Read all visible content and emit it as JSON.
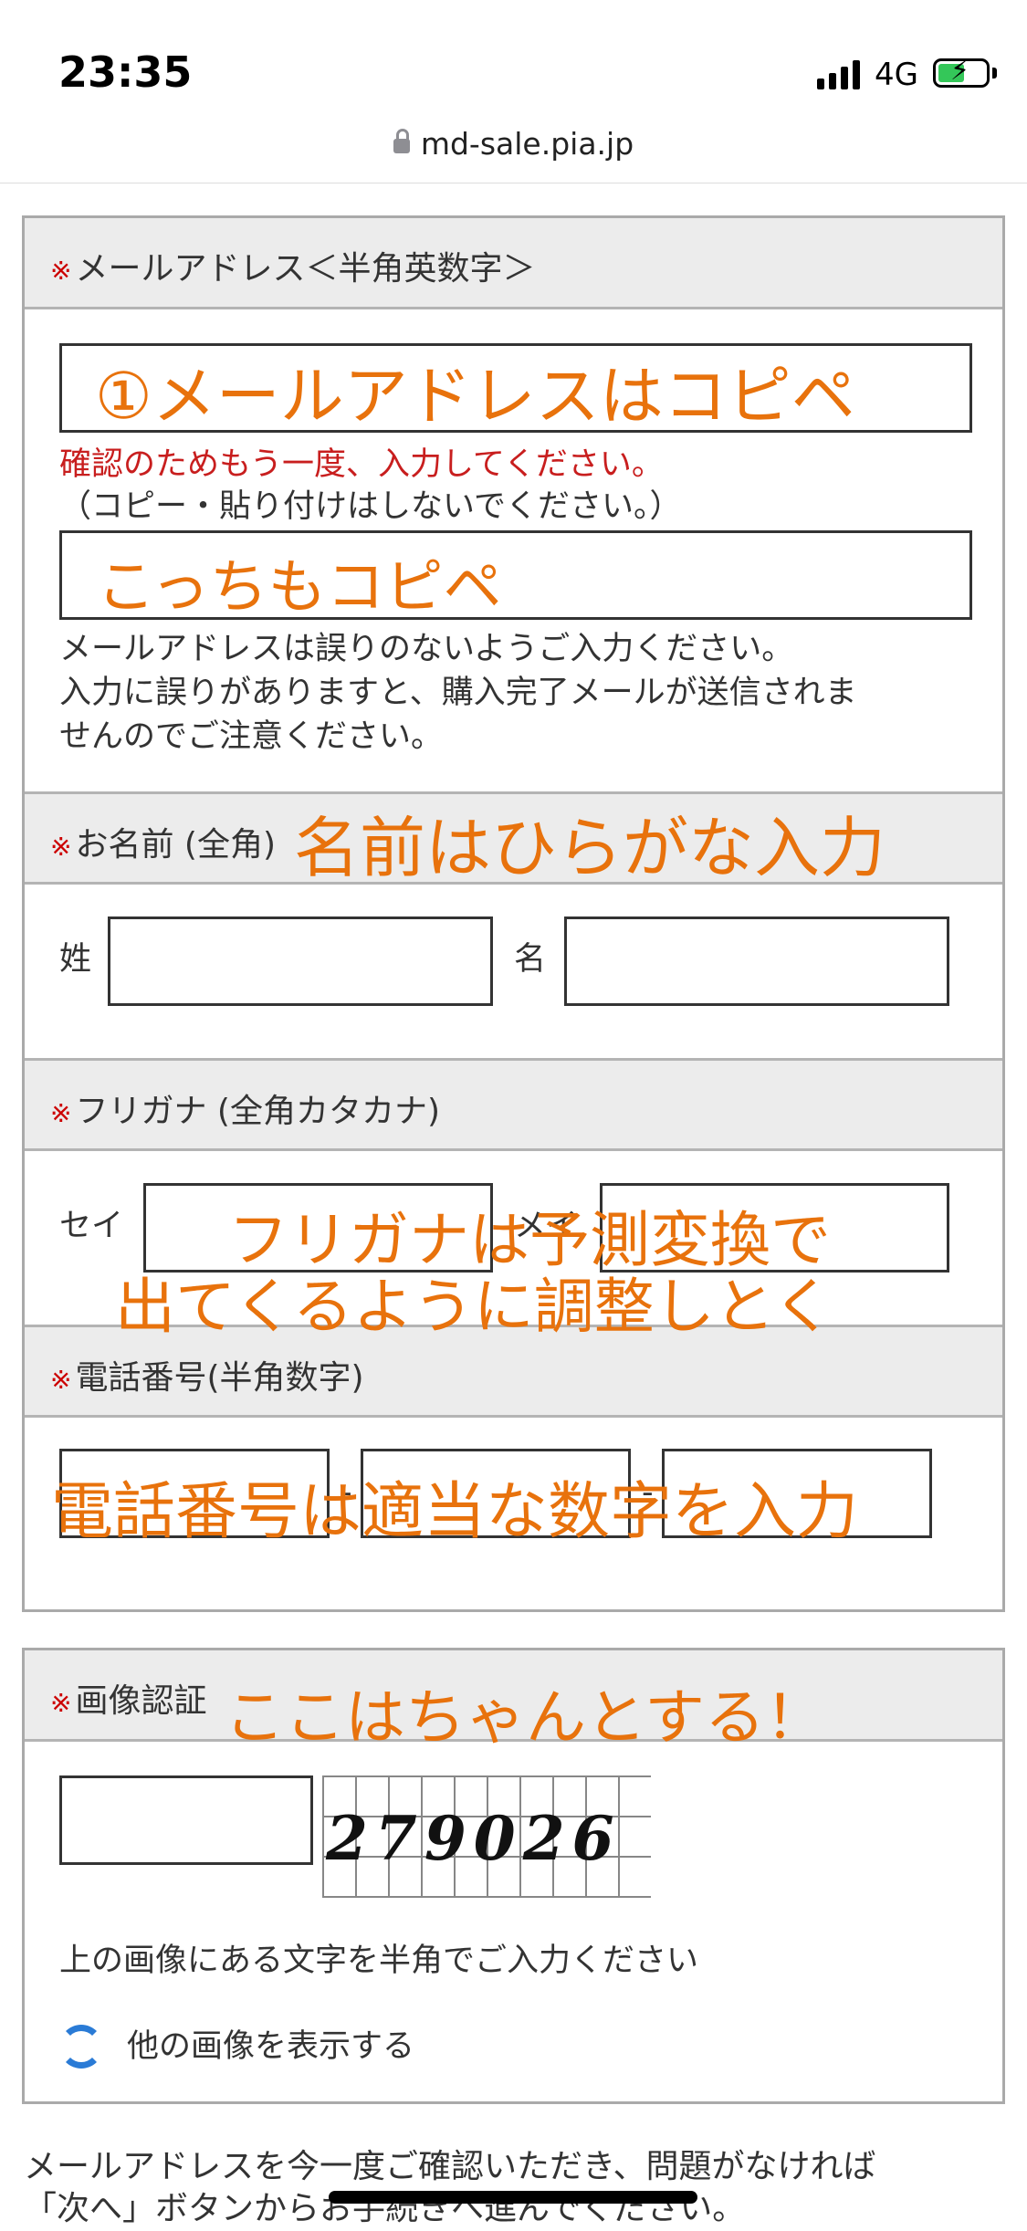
{
  "status_bar": {
    "time": "23:35",
    "network": "4G"
  },
  "browser": {
    "url": "md-sale.pia.jp"
  },
  "email_section": {
    "required_mark": "※",
    "label": "メールアドレス＜半角英数字＞",
    "input_value": "",
    "confirm_note": "確認のためもう一度、入力してください。",
    "confirm_sub": "（コピー・貼り付けはしないでください。）",
    "confirm_value": "",
    "warning_line1": "メールアドレスは誤りのないようご入力ください。",
    "warning_line2": "入力に誤りがありますと、購入完了メールが送信されま",
    "warning_line3": "せんのでご注意ください。"
  },
  "name_section": {
    "required_mark": "※",
    "label": "お名前 (全角)",
    "last_label": "姓",
    "first_label": "名"
  },
  "furigana_section": {
    "required_mark": "※",
    "label": "フリガナ (全角カタカナ)",
    "sei_label": "セイ",
    "mei_label": "メイ"
  },
  "phone_section": {
    "required_mark": "※",
    "label": "電話番号(半角数字)",
    "separator": "-"
  },
  "captcha_section": {
    "required_mark": "※",
    "label": "画像認証",
    "captcha_code": "279026",
    "instruction": "上の画像にある文字を半角でご入力ください",
    "refresh_label": "他の画像を表示する"
  },
  "footer": {
    "line1": "メールアドレスを今一度ご確認いただき、問題がなければ",
    "line2": "「次へ」ボタンからお手続きへ進んでください。"
  },
  "annotations": {
    "email": "①メールアドレスはコピペ",
    "email_confirm": "こっちもコピペ",
    "name": "名前はひらがな入力",
    "furigana_1": "フリガナは予測変換で",
    "furigana_2": "出てくるように調整しとく",
    "phone": "電話番号は適当な数字を入力",
    "captcha": "ここはちゃんとする！"
  },
  "colors": {
    "annotation": "#e8720c",
    "required": "#cc0000",
    "header_bg": "#ececec"
  }
}
